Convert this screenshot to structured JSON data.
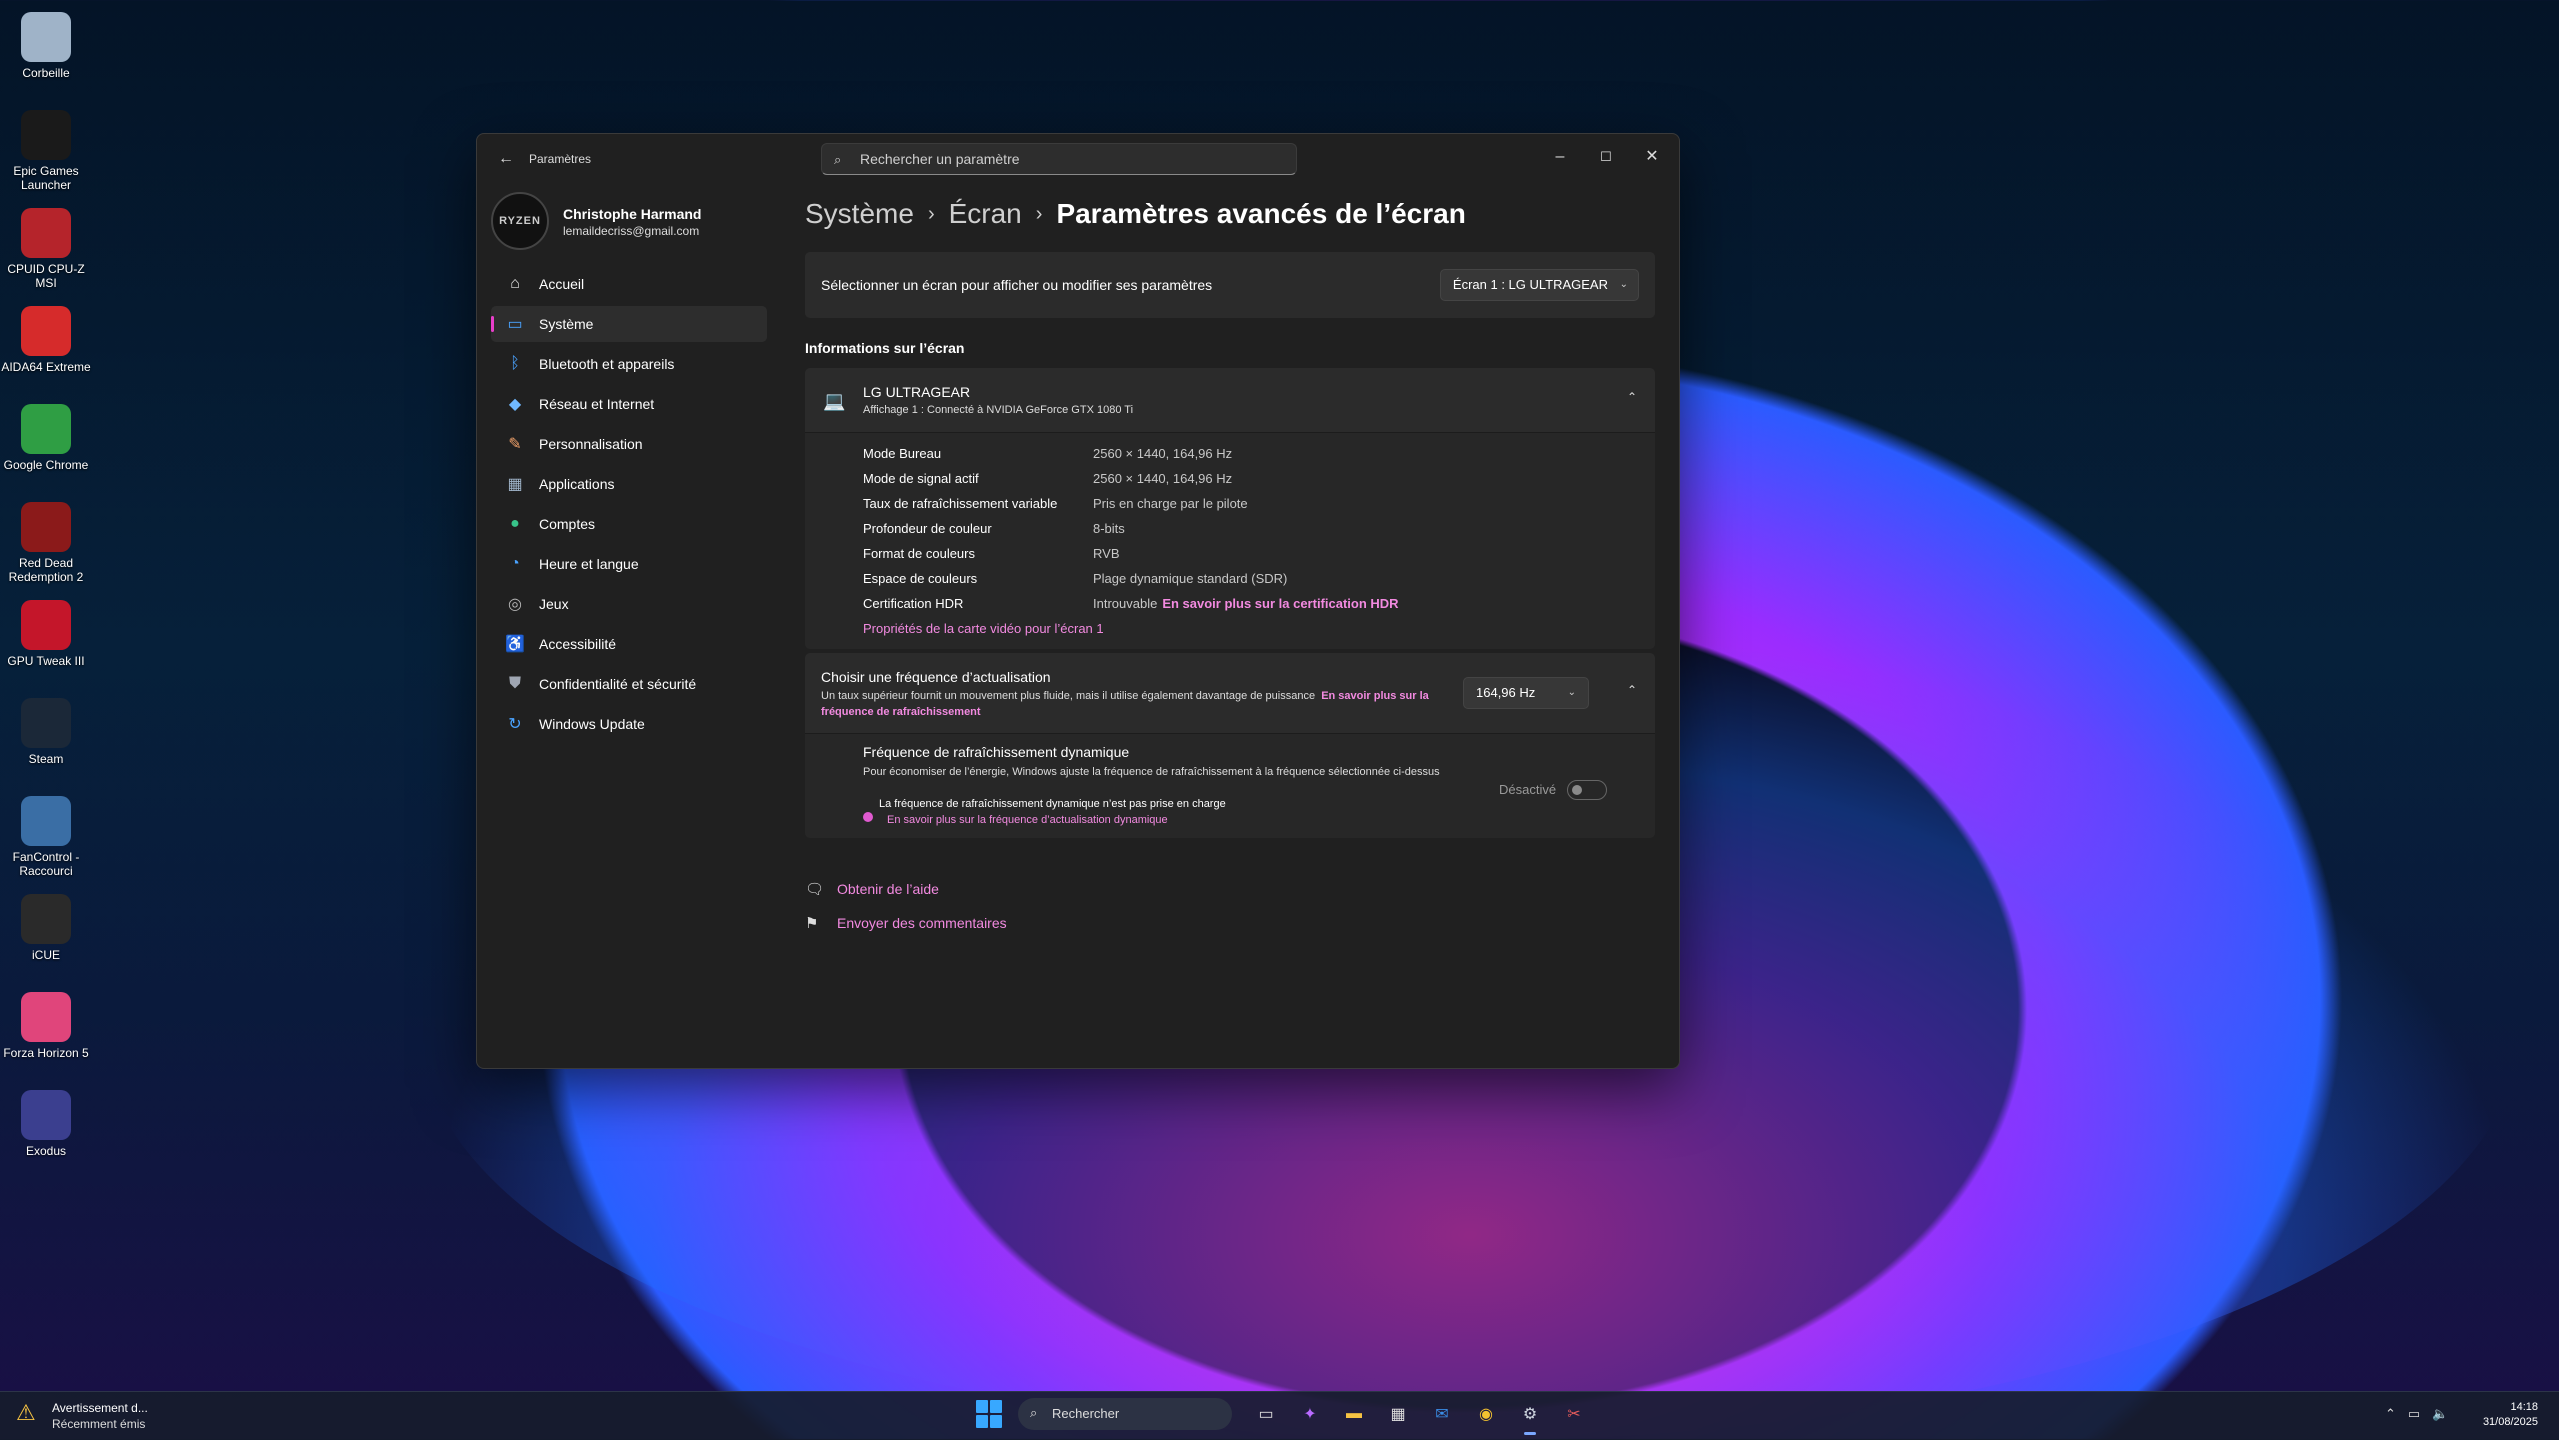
{
  "desktop": {
    "icons": [
      {
        "label": "Corbeille",
        "icon": "recycle-bin-icon",
        "color": "#9fb3c8"
      },
      {
        "label": "Epic Games Launcher",
        "icon": "epic-games-icon",
        "color": "#1a1a1a"
      },
      {
        "label": "CPUID CPU-Z MSI",
        "icon": "cpuz-icon",
        "color": "#b5242b"
      },
      {
        "label": "AIDA64 Extreme",
        "icon": "aida64-icon",
        "color": "#d62b2b"
      },
      {
        "label": "Google Chrome",
        "icon": "chrome-icon",
        "color": "#2f9e44"
      },
      {
        "label": "Red Dead Redemption 2",
        "icon": "rdr2-icon",
        "color": "#8b1a1a"
      },
      {
        "label": "GPU Tweak III",
        "icon": "gpu-tweak-icon",
        "color": "#c4162a"
      },
      {
        "label": "Steam",
        "icon": "steam-icon",
        "color": "#1b2838"
      },
      {
        "label": "FanControl - Raccourci",
        "icon": "fancontrol-icon",
        "color": "#3a6ea5"
      },
      {
        "label": "iCUE",
        "icon": "icue-icon",
        "color": "#2a2a2a"
      },
      {
        "label": "Forza Horizon 5",
        "icon": "forza-icon",
        "color": "#e0457b"
      },
      {
        "label": "Exodus",
        "icon": "exodus-icon",
        "color": "#3b3f8f"
      }
    ]
  },
  "window": {
    "app_title": "Paramètres",
    "search_placeholder": "Rechercher un paramètre",
    "accent": "#e83ec9"
  },
  "profile": {
    "avatar_text": "RYZEN",
    "name": "Christophe Harmand",
    "email": "lemaildecriss@gmail.com"
  },
  "nav": [
    {
      "label": "Accueil",
      "icon": "home-icon",
      "color": "#e6e6e6"
    },
    {
      "label": "Système",
      "icon": "monitor-icon",
      "color": "#4aa3ff",
      "selected": true
    },
    {
      "label": "Bluetooth et appareils",
      "icon": "bluetooth-icon",
      "color": "#4aa3ff"
    },
    {
      "label": "Réseau et Internet",
      "icon": "wifi-icon",
      "color": "#6fb8ff"
    },
    {
      "label": "Personnalisation",
      "icon": "brush-icon",
      "color": "#f2a36b"
    },
    {
      "label": "Applications",
      "icon": "apps-icon",
      "color": "#9fb3c8"
    },
    {
      "label": "Comptes",
      "icon": "person-icon",
      "color": "#38c48a"
    },
    {
      "label": "Heure et langue",
      "icon": "globe-clock-icon",
      "color": "#4aa3ff"
    },
    {
      "label": "Jeux",
      "icon": "gamepad-icon",
      "color": "#b5b5b5"
    },
    {
      "label": "Accessibilité",
      "icon": "accessibility-icon",
      "color": "#4aa3ff"
    },
    {
      "label": "Confidentialité et sécurité",
      "icon": "shield-icon",
      "color": "#9fa6b2"
    },
    {
      "label": "Windows Update",
      "icon": "update-icon",
      "color": "#4aa3ff"
    }
  ],
  "breadcrumb": {
    "level1": "Système",
    "level2": "Écran",
    "current": "Paramètres avancés de l’écran"
  },
  "display_select": {
    "label": "Sélectionner un écran pour afficher ou modifier ses paramètres",
    "value": "Écran 1 : LG ULTRAGEAR"
  },
  "info": {
    "section_title": "Informations sur l’écran",
    "monitor_name": "LG ULTRAGEAR",
    "monitor_sub": "Affichage 1 : Connecté à NVIDIA GeForce GTX 1080 Ti",
    "rows": [
      {
        "key": "Mode Bureau",
        "value": "2560 × 1440, 164,96 Hz"
      },
      {
        "key": "Mode de signal actif",
        "value": "2560 × 1440, 164,96 Hz"
      },
      {
        "key": "Taux de rafraîchissement variable",
        "value": "Pris en charge par le pilote"
      },
      {
        "key": "Profondeur de couleur",
        "value": "8-bits"
      },
      {
        "key": "Format de couleurs",
        "value": "RVB"
      },
      {
        "key": "Espace de couleurs",
        "value": "Plage dynamique standard (SDR)"
      },
      {
        "key": "Certification HDR",
        "value": "Introuvable",
        "link": "En savoir plus sur la certification HDR"
      }
    ],
    "adapter_link": "Propriétés de la carte vidéo pour l’écran 1"
  },
  "refresh": {
    "title": "Choisir une fréquence d’actualisation",
    "desc": "Un taux supérieur fournit un mouvement plus fluide, mais il utilise également davantage de puissance",
    "desc_link": "En savoir plus sur la fréquence de rafraîchissement",
    "value": "164,96 Hz"
  },
  "dynamic": {
    "title": "Fréquence de rafraîchissement dynamique",
    "desc": "Pour économiser de l’énergie, Windows ajuste la fréquence de rafraîchissement à la fréquence sélectionnée ci-dessus",
    "warning": "La fréquence de rafraîchissement dynamique n’est pas prise en charge",
    "warning_link": "En savoir plus sur la fréquence d’actualisation dynamique",
    "toggle_label": "Désactivé",
    "enabled": false
  },
  "help": {
    "get_help": "Obtenir de l’aide",
    "feedback": "Envoyer des commentaires"
  },
  "taskbar": {
    "notif_title": "Avertissement d...",
    "notif_sub": "Récemment émis",
    "search": "Rechercher",
    "apps": [
      {
        "name": "task-view-icon",
        "glyph": "▭",
        "color": "#ddd"
      },
      {
        "name": "copilot-icon",
        "glyph": "✦",
        "color": "#b96bff"
      },
      {
        "name": "file-explorer-icon",
        "glyph": "▬",
        "color": "#f6c343"
      },
      {
        "name": "store-icon",
        "glyph": "▦",
        "color": "#ddd"
      },
      {
        "name": "outlook-icon",
        "glyph": "✉",
        "color": "#3a8ee6"
      },
      {
        "name": "chrome-taskbar-icon",
        "glyph": "◉",
        "color": "#f2c230"
      },
      {
        "name": "settings-taskbar-icon",
        "glyph": "⚙",
        "color": "#cfd6e0",
        "active": true
      },
      {
        "name": "snipping-tool-icon",
        "glyph": "✂",
        "color": "#e45b5b"
      }
    ],
    "time": "14:18",
    "date": "31/08/2025"
  }
}
